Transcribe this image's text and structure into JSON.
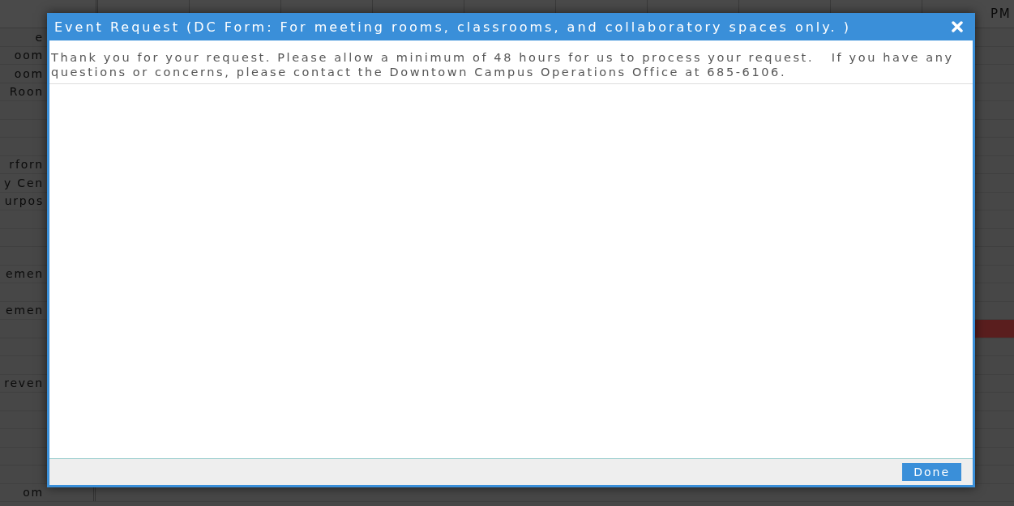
{
  "schedule": {
    "header_fragment": "PM",
    "rows": [
      {
        "label": "e"
      },
      {
        "label": "oom"
      },
      {
        "label": "oom"
      },
      {
        "label": "Roon"
      },
      {},
      {},
      {},
      {
        "label": "rforn"
      },
      {
        "label": "y Cen"
      },
      {
        "label": "urpos"
      },
      {},
      {},
      {},
      {
        "label": "emen"
      },
      {},
      {
        "label": "emen"
      },
      {
        "event": true
      },
      {},
      {},
      {
        "label": "reven"
      },
      {},
      {},
      {},
      {},
      {},
      {
        "label": "om"
      }
    ]
  },
  "dialog": {
    "title": "Event Request (DC Form: For meeting rooms, classrooms, and collaboratory spaces only. )",
    "message": "Thank you for your request. Please allow a minimum of 48 hours for us to process your request.   If you have any questions or concerns, please contact the Downtown Campus Operations Office at 685-6106.",
    "buttons": [
      "Done"
    ]
  }
}
